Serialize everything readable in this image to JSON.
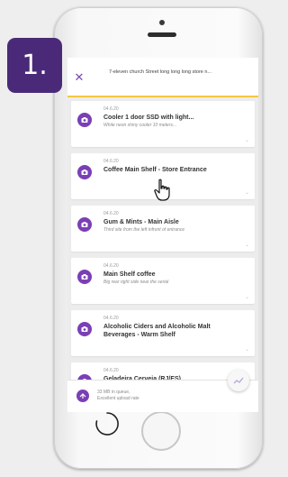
{
  "step_number": "1.",
  "header": {
    "store_name": "7-eleven church Street long long long store n..."
  },
  "items": [
    {
      "date": "04.6.20",
      "title": "Cooler 1 door SSD with light...",
      "description": "White neon shiny cooler 10 meters..."
    },
    {
      "date": "04.6.20",
      "title": "Coffee Main Shelf - Store Entrance",
      "description": ""
    },
    {
      "date": "04.6.20",
      "title": "Gum & Mints - Main Aisle",
      "description": "Third site from the left infront of entrance"
    },
    {
      "date": "04.6.20",
      "title": "Main Shelf coffee",
      "description": "Big rear right side near the serial"
    },
    {
      "date": "04.6.20",
      "title": "Alcoholic Ciders and Alcoholic Malt Beverages - Warm Shelf",
      "description": ""
    },
    {
      "date": "04.6.20",
      "title": "Geladeira Cerveja (RJ/ES)",
      "description": ""
    }
  ],
  "footer": {
    "queue_text": "33 MB in queue,",
    "upload_rate": "Excellent upload rate"
  },
  "colors": {
    "accent": "#7b3fb5",
    "header_border": "#f3c742",
    "badge_bg": "#4a2a78"
  }
}
